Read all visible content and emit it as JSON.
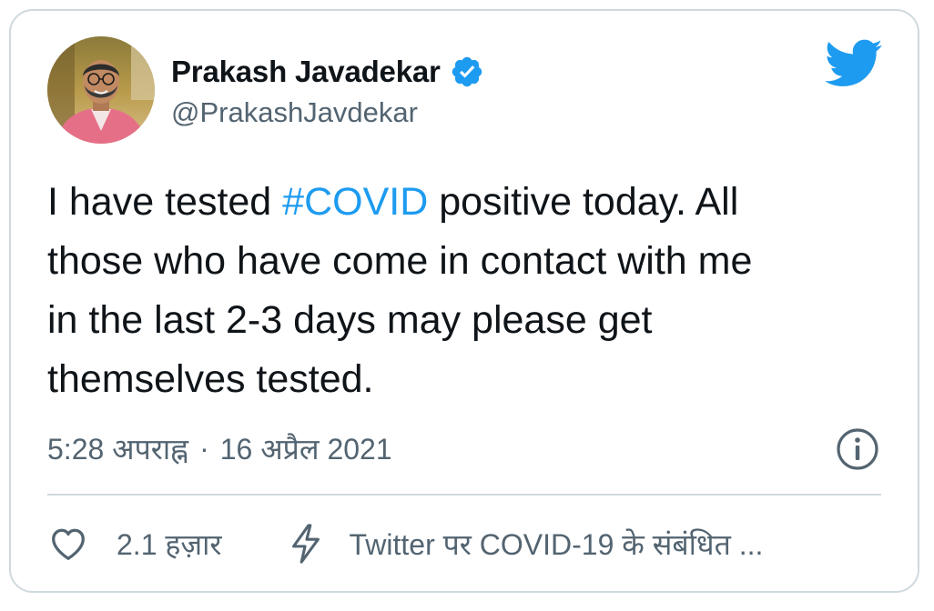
{
  "tweet": {
    "author": {
      "display_name": "Prakash Javadekar",
      "handle": "@PrakashJavdekar",
      "verified": true
    },
    "text_lines": [
      {
        "before": "I have tested ",
        "hashtag": "#COVID",
        "after": " positive today. All"
      },
      {
        "text": "those who have come in contact with me"
      },
      {
        "text": "in the last 2-3 days may please get"
      },
      {
        "text": "themselves tested."
      }
    ],
    "time": "5:28 अपराह्न",
    "separator": "·",
    "date": "16 अप्रैल 2021",
    "likes": "2.1 हज़ार",
    "topic_link": "Twitter पर COVID-19 के संबंधित ..."
  },
  "icons": {
    "bird": "twitter-bird-icon",
    "verified": "verified-badge-icon",
    "info": "info-icon",
    "like": "heart-icon",
    "topic": "lightning-bolt-icon"
  },
  "colors": {
    "accent": "#1d9bf0",
    "text_primary": "#0f1419",
    "text_secondary": "#536471",
    "border": "#cfd9de"
  }
}
